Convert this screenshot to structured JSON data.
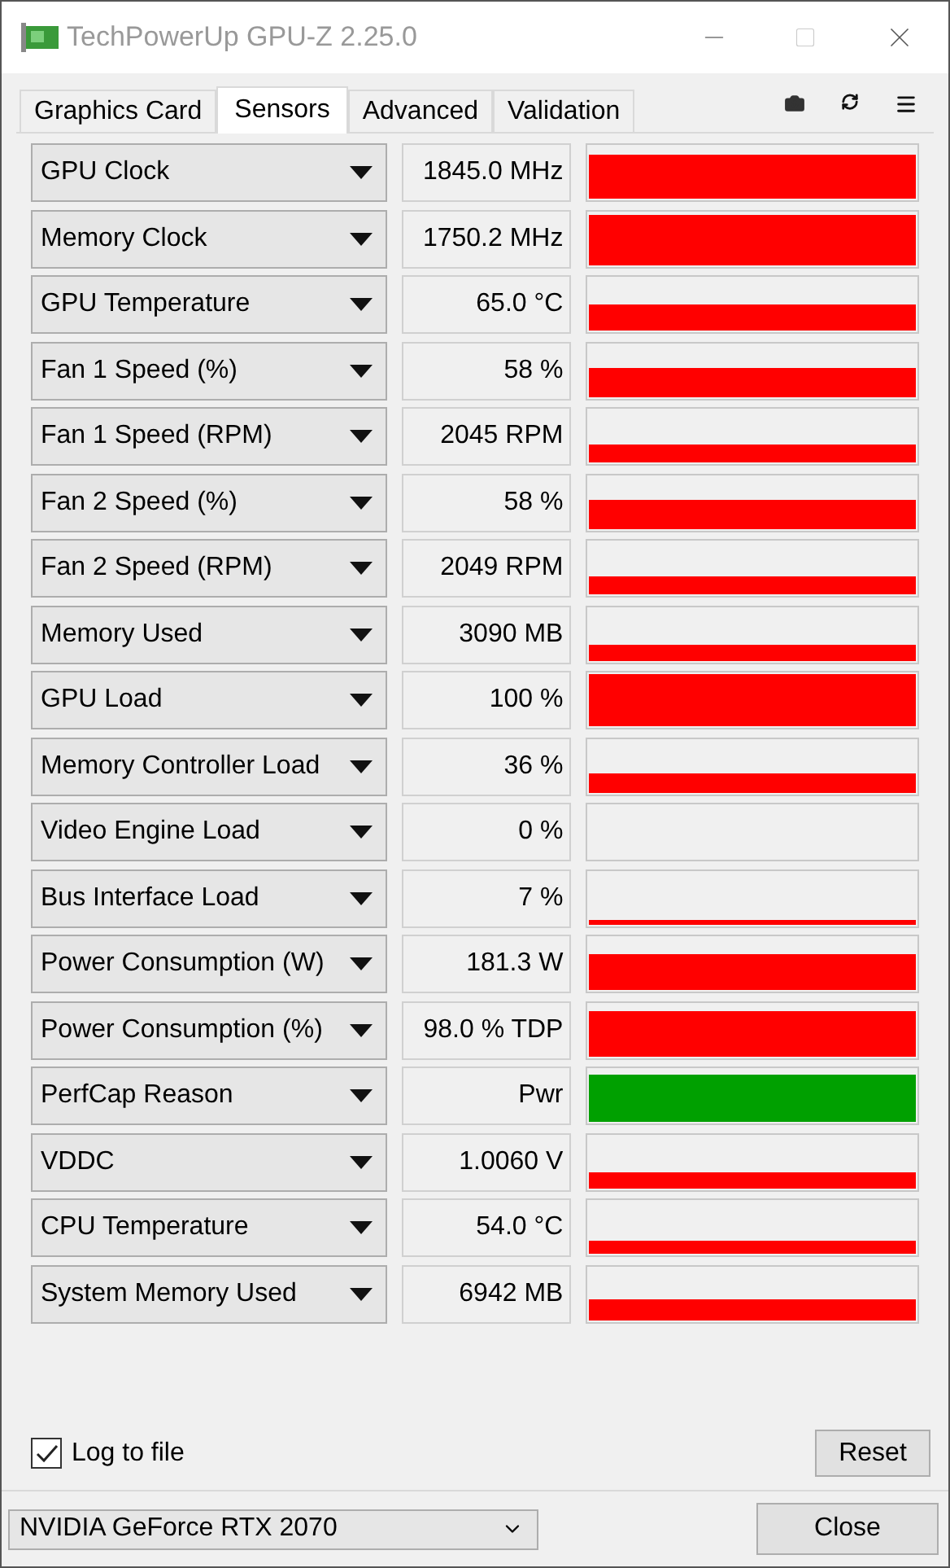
{
  "window": {
    "title": "TechPowerUp GPU-Z 2.25.0"
  },
  "tabs": [
    {
      "label": "Graphics Card",
      "selected": false
    },
    {
      "label": "Sensors",
      "selected": true
    },
    {
      "label": "Advanced",
      "selected": false
    },
    {
      "label": "Validation",
      "selected": false
    }
  ],
  "sensors": [
    {
      "name": "GPU Clock",
      "value": "1845.0 MHz",
      "color": "#ff0000"
    },
    {
      "name": "Memory Clock",
      "value": "1750.2 MHz",
      "color": "#ff0000"
    },
    {
      "name": "GPU Temperature",
      "value": "65.0 °C",
      "color": "#ff0000"
    },
    {
      "name": "Fan 1 Speed (%)",
      "value": "58 %",
      "color": "#ff0000"
    },
    {
      "name": "Fan 1 Speed (RPM)",
      "value": "2045 RPM",
      "color": "#ff0000"
    },
    {
      "name": "Fan 2 Speed (%)",
      "value": "58 %",
      "color": "#ff0000"
    },
    {
      "name": "Fan 2 Speed (RPM)",
      "value": "2049 RPM",
      "color": "#ff0000"
    },
    {
      "name": "Memory Used",
      "value": "3090 MB",
      "color": "#ff0000"
    },
    {
      "name": "GPU Load",
      "value": "100 %",
      "color": "#ff0000"
    },
    {
      "name": "Memory Controller Load",
      "value": "36 %",
      "color": "#ff0000"
    },
    {
      "name": "Video Engine Load",
      "value": "0 %"
    },
    {
      "name": "Bus Interface Load",
      "value": "7 %",
      "color": "#ff0000"
    },
    {
      "name": "Power Consumption (W)",
      "value": "181.3 W",
      "color": "#ff0000"
    },
    {
      "name": "Power Consumption (%)",
      "value": "98.0 % TDP",
      "color": "#ff0000"
    },
    {
      "name": "PerfCap Reason",
      "value": "Pwr",
      "color": "#00a000"
    },
    {
      "name": "VDDC",
      "value": "1.0060 V",
      "color": "#ff0000"
    },
    {
      "name": "CPU Temperature",
      "value": "54.0 °C",
      "color": "#ff0000"
    },
    {
      "name": "System Memory Used",
      "value": "6942 MB",
      "color": "#ff0000"
    }
  ],
  "log_to_file": {
    "label": "Log to file",
    "checked": true
  },
  "reset_button": "Reset",
  "device": "NVIDIA GeForce RTX 2070",
  "close_button": "Close"
}
